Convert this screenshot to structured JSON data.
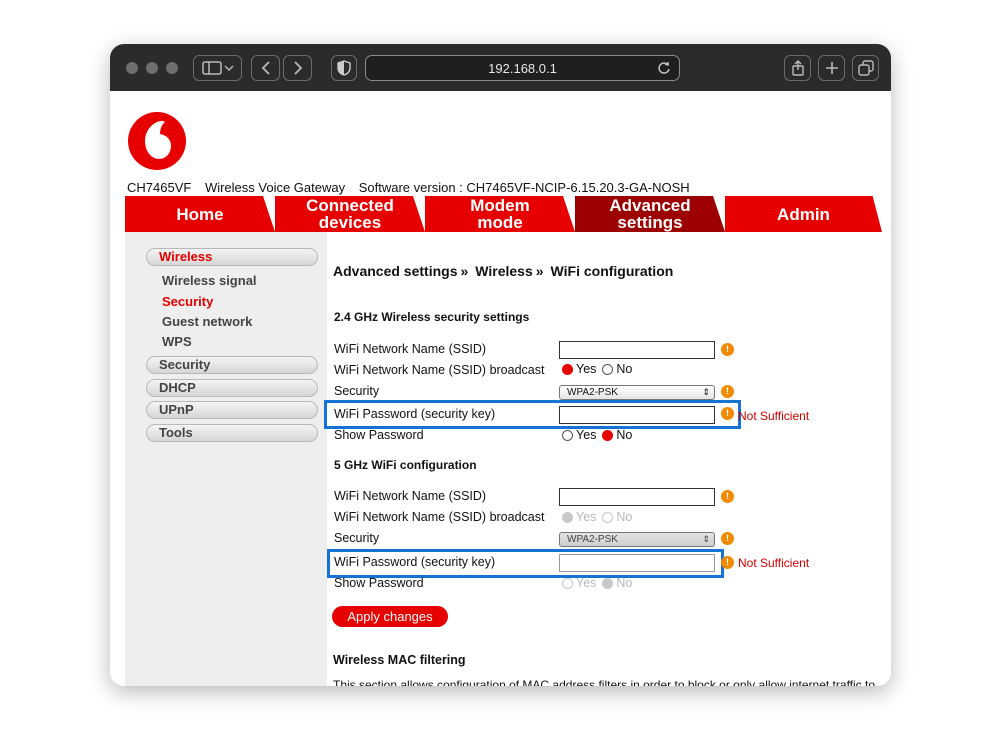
{
  "browser": {
    "url": "192.168.0.1"
  },
  "header": {
    "model": "CH7465VF",
    "product": "Wireless Voice Gateway",
    "software": "Software version : CH7465VF-NCIP-6.15.20.3-GA-NOSH"
  },
  "tabs": [
    {
      "label": "Home"
    },
    {
      "label": "Connected devices"
    },
    {
      "label": "Modem mode"
    },
    {
      "label": "Advanced settings"
    },
    {
      "label": "Admin"
    }
  ],
  "sidebar": {
    "wireless": "Wireless",
    "wireless_signal": "Wireless signal",
    "security_sub": "Security",
    "guest_network": "Guest network",
    "wps": "WPS",
    "security": "Security",
    "dhcp": "DHCP",
    "upnp": "UPnP",
    "tools": "Tools"
  },
  "breadcrumb": {
    "part1": "Advanced settings",
    "part2": "Wireless",
    "part3": "WiFi configuration",
    "sep": "»"
  },
  "band24": {
    "title": "2.4 GHz Wireless security settings",
    "ssid_label": "WiFi Network Name (SSID)",
    "ssid_value": "",
    "broadcast_label": "WiFi Network Name (SSID) broadcast",
    "security_label": "Security",
    "security_value": "WPA2-PSK",
    "password_label": "WiFi Password (security key)",
    "password_value": "",
    "password_status": "Not Sufficient",
    "show_password_label": "Show Password"
  },
  "band5": {
    "title": "5 GHz WiFi configuration",
    "ssid_label": "WiFi Network Name (SSID)",
    "ssid_value": "",
    "broadcast_label": "WiFi Network Name (SSID) broadcast",
    "security_label": "Security",
    "security_value": "WPA2-PSK",
    "password_label": "WiFi Password (security key)",
    "password_value": "",
    "password_status": "Not Sufficient",
    "show_password_label": "Show Password"
  },
  "options": {
    "yes": "Yes",
    "no": "No"
  },
  "apply_label": "Apply changes",
  "mac": {
    "title": "Wireless MAC filtering",
    "description": "This section allows configuration of MAC address filters in order to block or only allow internet traffic to"
  },
  "colors": {
    "brand_red": "#e60000",
    "active_tab": "#9c0000",
    "highlight": "#1673d6",
    "warning": "#f08a00"
  }
}
